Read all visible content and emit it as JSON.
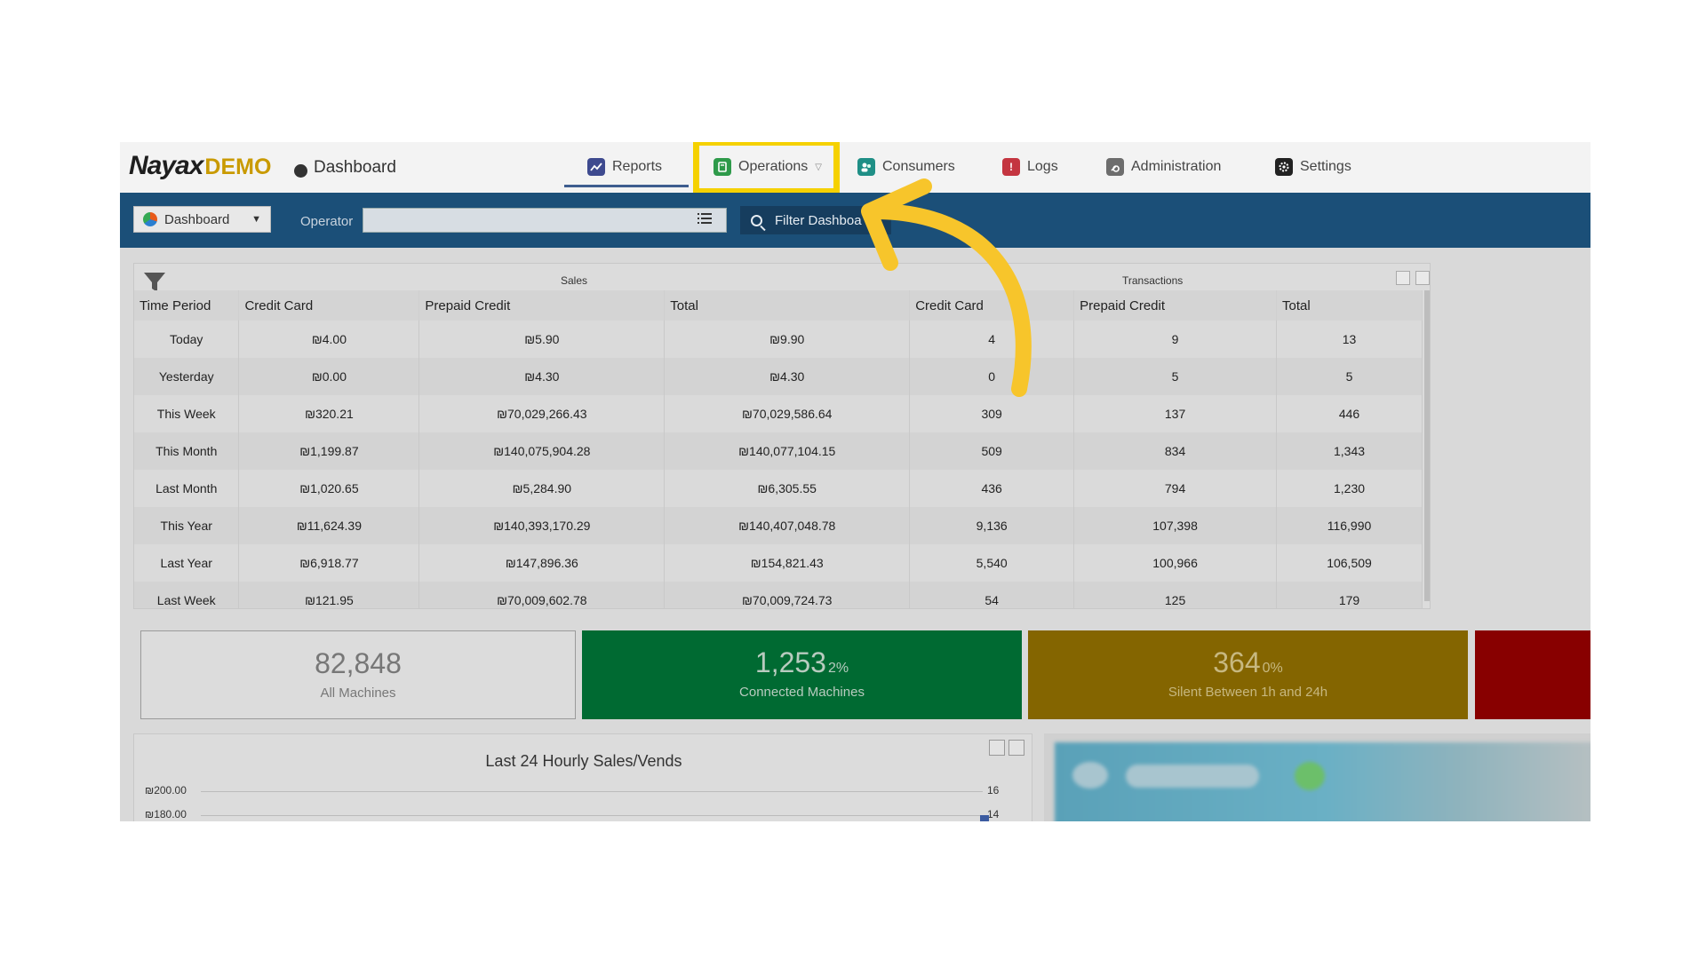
{
  "header": {
    "logo_main": "Nayax",
    "logo_demo": "DEMO",
    "page_title": "Dashboard",
    "nav": [
      {
        "label": "Reports",
        "icon": "reports-icon",
        "color": "#3e4a8f"
      },
      {
        "label": "Operations",
        "icon": "operations-icon",
        "color": "#2e9a4a"
      },
      {
        "label": "Consumers",
        "icon": "consumers-icon",
        "color": "#1f8f86"
      },
      {
        "label": "Logs",
        "icon": "logs-icon",
        "color": "#c43540"
      },
      {
        "label": "Administration",
        "icon": "administration-icon",
        "color": "#6d6d6d"
      },
      {
        "label": "Settings",
        "icon": "settings-icon",
        "color": "#222222"
      }
    ],
    "highlight_color": "#f5d100"
  },
  "filterbar": {
    "dashboard_select": "Dashboard",
    "operator_label": "Operator",
    "operator_value": "",
    "filter_button": "Filter Dashboa"
  },
  "table": {
    "group_sales": "Sales",
    "group_transactions": "Transactions",
    "columns": [
      "Time Period",
      "Credit Card",
      "Prepaid Credit",
      "Total",
      "Credit Card",
      "Prepaid Credit",
      "Total"
    ],
    "rows": [
      [
        "Today",
        "₪4.00",
        "₪5.90",
        "₪9.90",
        "4",
        "9",
        "13"
      ],
      [
        "Yesterday",
        "₪0.00",
        "₪4.30",
        "₪4.30",
        "0",
        "5",
        "5"
      ],
      [
        "This Week",
        "₪320.21",
        "₪70,029,266.43",
        "₪70,029,586.64",
        "309",
        "137",
        "446"
      ],
      [
        "This Month",
        "₪1,199.87",
        "₪140,075,904.28",
        "₪140,077,104.15",
        "509",
        "834",
        "1,343"
      ],
      [
        "Last Month",
        "₪1,020.65",
        "₪5,284.90",
        "₪6,305.55",
        "436",
        "794",
        "1,230"
      ],
      [
        "This Year",
        "₪11,624.39",
        "₪140,393,170.29",
        "₪140,407,048.78",
        "9,136",
        "107,398",
        "116,990"
      ],
      [
        "Last Year",
        "₪6,918.77",
        "₪147,896.36",
        "₪154,821.43",
        "5,540",
        "100,966",
        "106,509"
      ],
      [
        "Last Week",
        "₪121.95",
        "₪70,009,602.78",
        "₪70,009,724.73",
        "54",
        "125",
        "179"
      ]
    ]
  },
  "stats": {
    "all": {
      "value": "82,848",
      "label": "All Machines"
    },
    "connected": {
      "value": "1,253",
      "pct": "2%",
      "label": "Connected Machines",
      "color": "#006a32"
    },
    "silent": {
      "value": "364",
      "pct": "0%",
      "label": "Silent Between 1h and 24h",
      "color": "#846500"
    },
    "offline_color": "#880000"
  },
  "chart": {
    "title": "Last 24 Hourly Sales/Vends",
    "y_left": [
      "₪200.00",
      "₪180.00"
    ],
    "y_right": [
      "16",
      "14"
    ]
  }
}
